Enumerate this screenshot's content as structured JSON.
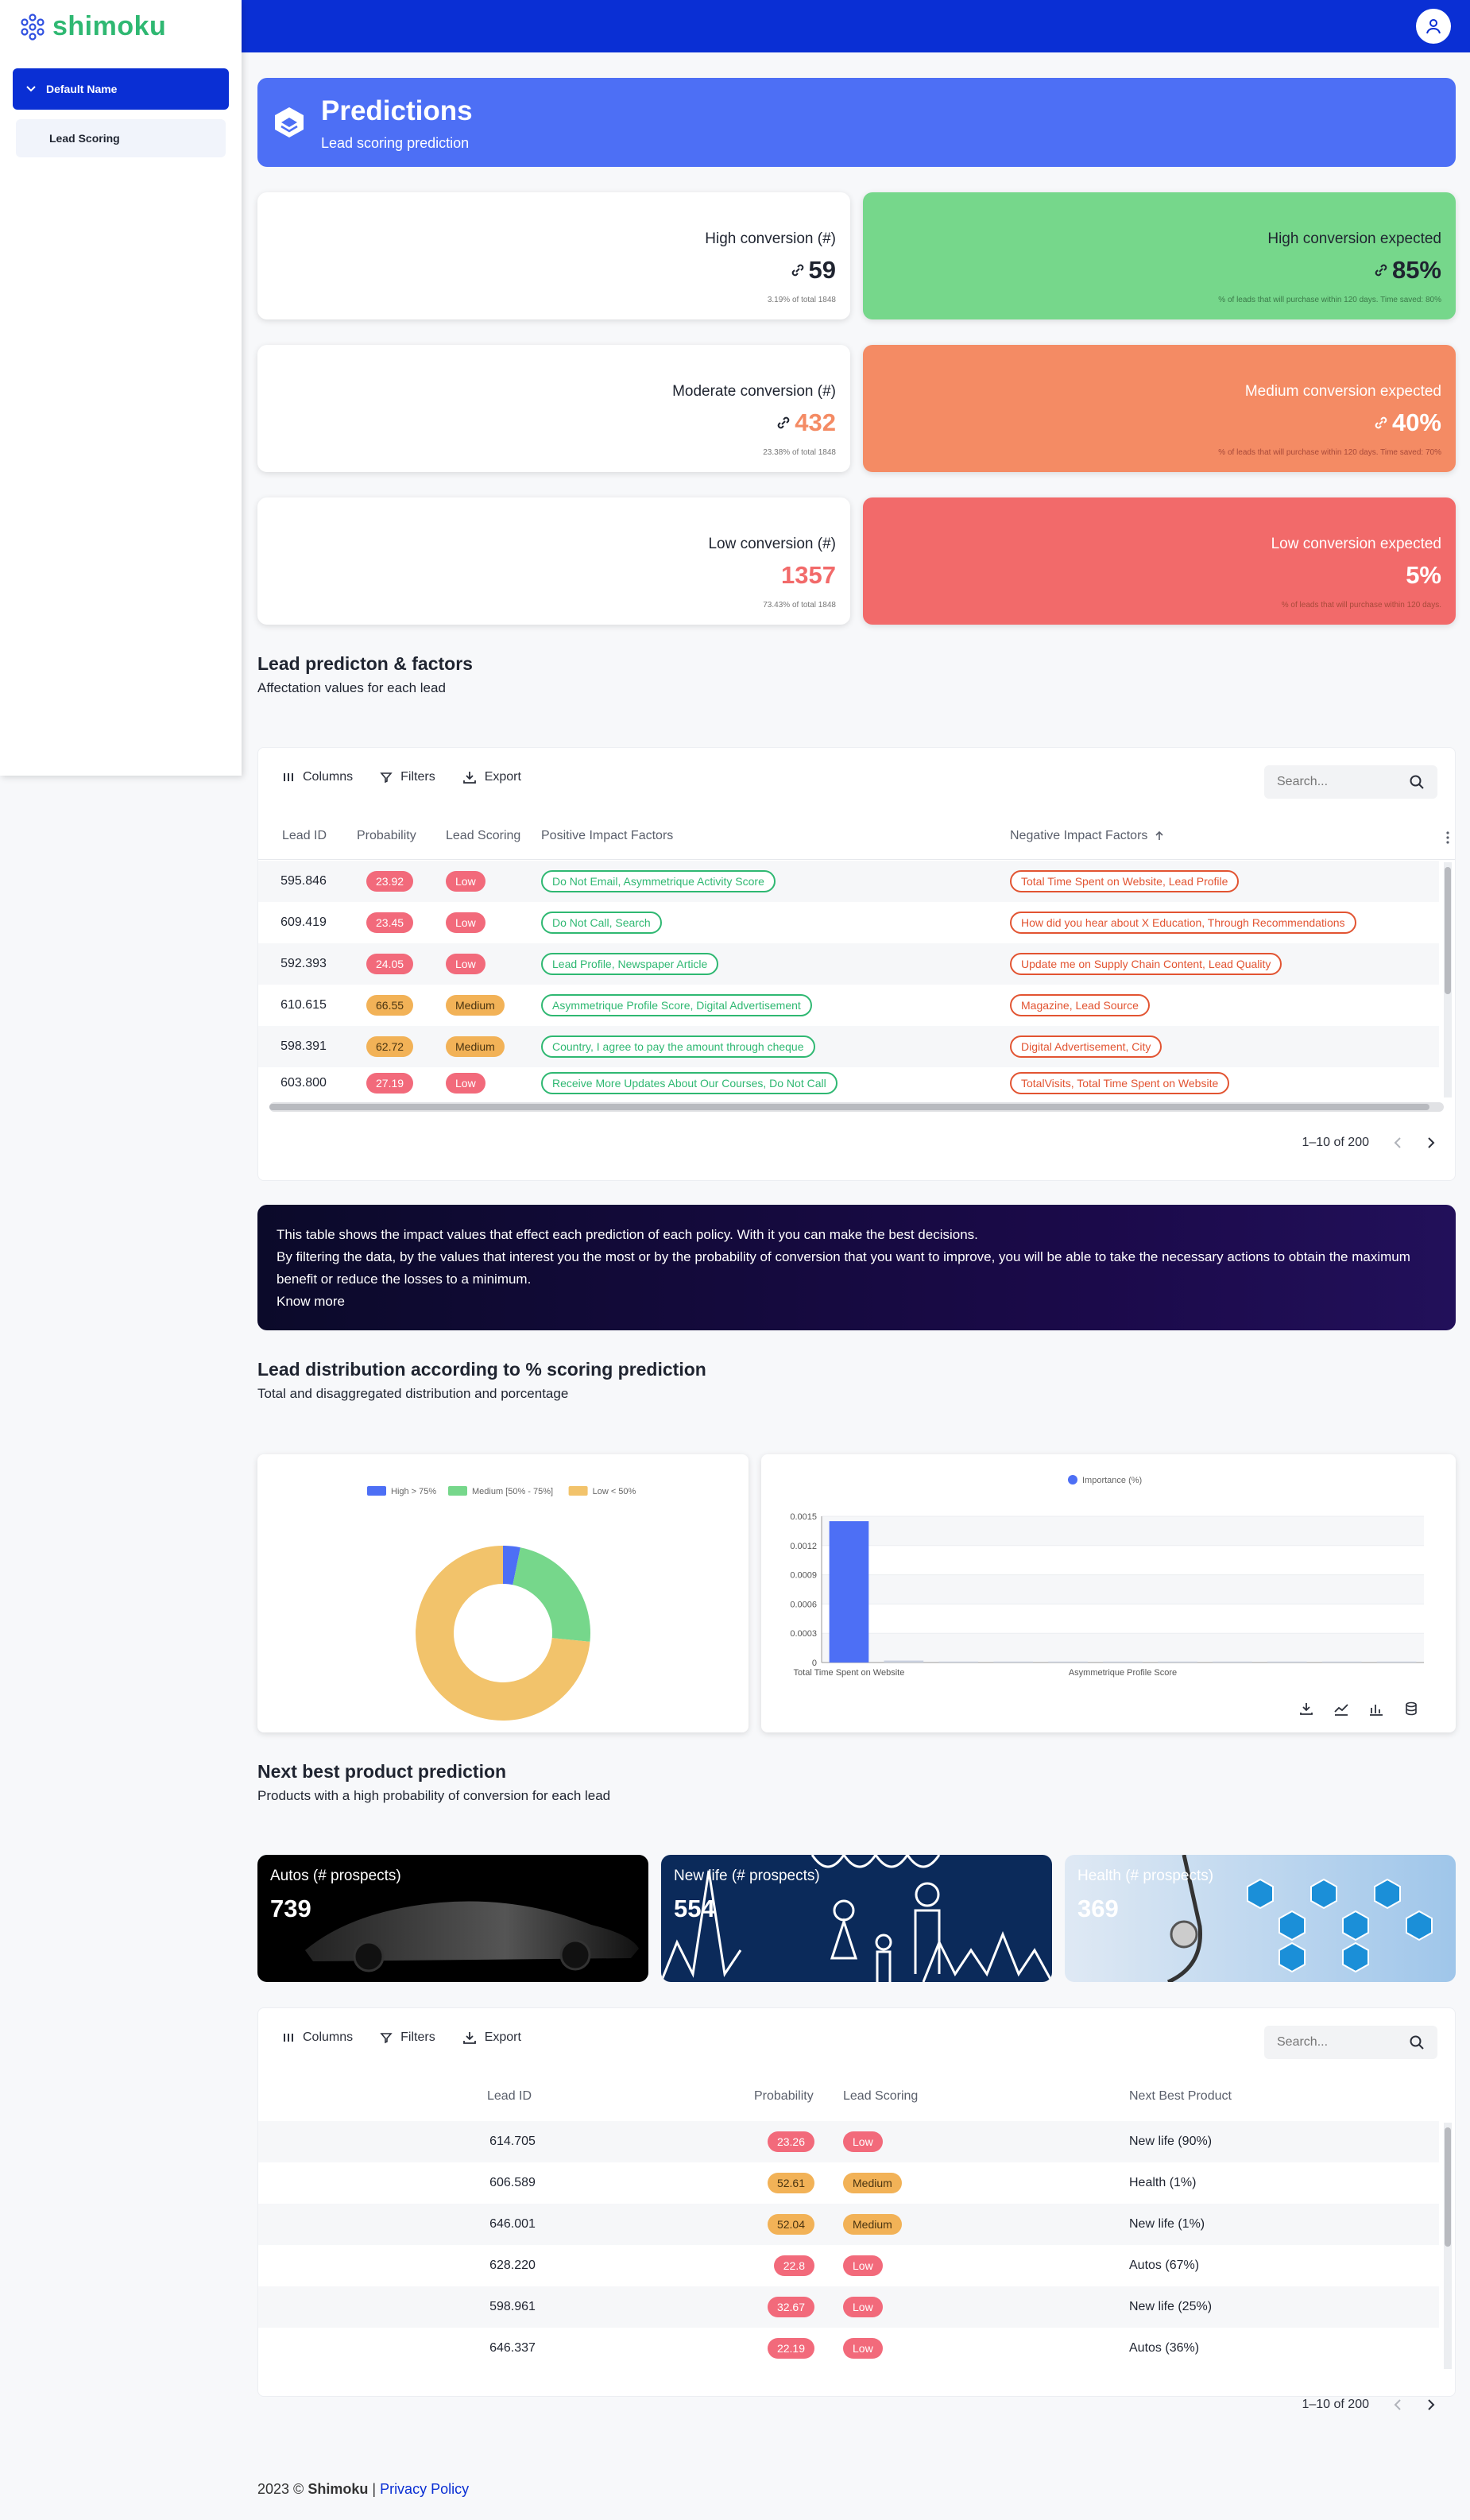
{
  "app": {
    "logo_text": "shimoku"
  },
  "sidebar": {
    "group_label": "Default Name",
    "items": [
      {
        "label": "Lead Scoring"
      }
    ]
  },
  "hero": {
    "title": "Predictions",
    "subtitle": "Lead scoring prediction"
  },
  "indicators": {
    "high_count": {
      "title": "High conversion (#)",
      "value": "59",
      "desc": "3.19% of total 1848"
    },
    "high_expected": {
      "title": "High conversion expected",
      "value": "85%",
      "desc": "% of leads that will purchase within 120 days. Time saved: 80%"
    },
    "moderate_count": {
      "title": "Moderate conversion (#)",
      "value": "432",
      "desc": "23.38% of total 1848"
    },
    "medium_expected": {
      "title": "Medium conversion expected",
      "value": "40%",
      "desc": "% of leads that will purchase within 120 days. Time saved: 70%"
    },
    "low_count": {
      "title": "Low conversion (#)",
      "value": "1357",
      "desc": "73.43% of total 1848"
    },
    "low_expected": {
      "title": "Low conversion expected",
      "value": "5%",
      "desc": "% of leads that will purchase within 120 days."
    }
  },
  "section_factors": {
    "title": "Lead predicton & factors",
    "subtitle": "Affectation values for each lead"
  },
  "toolbar": {
    "columns": "Columns",
    "filters": "Filters",
    "export": "Export",
    "search_placeholder": "Search..."
  },
  "table1": {
    "headers": [
      "Lead ID",
      "Probability",
      "Lead Scoring",
      "Positive Impact Factors",
      "Negative Impact Factors"
    ],
    "rows": [
      {
        "id": "595.846",
        "prob": "23.92",
        "score": "Low",
        "pos": "Do Not Email, Asymmetrique Activity Score",
        "neg": "Total Time Spent on Website, Lead Profile"
      },
      {
        "id": "609.419",
        "prob": "23.45",
        "score": "Low",
        "pos": "Do Not Call, Search",
        "neg": "How did you hear about X Education, Through Recommendations"
      },
      {
        "id": "592.393",
        "prob": "24.05",
        "score": "Low",
        "pos": "Lead Profile, Newspaper Article",
        "neg": "Update me on Supply Chain Content, Lead Quality"
      },
      {
        "id": "610.615",
        "prob": "66.55",
        "score": "Medium",
        "pos": "Asymmetrique Profile Score, Digital Advertisement",
        "neg": "Magazine, Lead Source"
      },
      {
        "id": "598.391",
        "prob": "62.72",
        "score": "Medium",
        "pos": "Country, I agree to pay the amount through cheque",
        "neg": "Digital Advertisement, City"
      },
      {
        "id": "603.800",
        "prob": "27.19",
        "score": "Low",
        "pos": "Receive More Updates About Our Courses, Do Not Call",
        "neg": "TotalVisits, Total Time Spent on Website"
      }
    ],
    "pagination": "1–10 of 200"
  },
  "banner": {
    "line1": "This table shows the impact values that effect each prediction of each policy. With it you can make the best decisions.",
    "line2": "By filtering the data, by the values that interest you the most or by the probability of conversion that you want to improve, you will be able to take the necessary actions to obtain the maximum benefit or reduce the losses to a minimum.",
    "link": "Know more"
  },
  "section_distribution": {
    "title": "Lead distribution according to % scoring prediction",
    "subtitle": "Total and disaggregated distribution and porcentage"
  },
  "chart_data": [
    {
      "type": "pie",
      "donut": true,
      "legend_position": "top",
      "categories": [
        "High > 75%",
        "Medium [50% - 75%]",
        "Low < 50%"
      ],
      "values": [
        59,
        432,
        1357
      ],
      "colors": [
        "#4d6ff5",
        "#76d78b",
        "#f2c36b"
      ]
    },
    {
      "type": "bar",
      "legend_position": "top",
      "series": [
        {
          "name": "Importance (%)",
          "values": [
            0.00145,
            2e-05,
            1e-05,
            1e-05,
            1e-05,
            1e-05,
            1e-05,
            1e-05,
            1e-05,
            1e-05,
            1e-05
          ]
        }
      ],
      "categories": [
        "Total Time Spent on Website",
        "",
        "",
        "",
        "",
        "Asymmetrique Profile Score",
        "",
        "",
        "",
        "",
        ""
      ],
      "tick_labels_x": [
        "Total Time Spent on Website",
        "Asymmetrique Profile Score"
      ],
      "y_ticks": [
        "0",
        "0.0003",
        "0.0006",
        "0.0009",
        "0.0012",
        "0.0015"
      ],
      "ylim": [
        0,
        0.0015
      ],
      "grid": true,
      "color": "#4d6ff5"
    }
  ],
  "section_products": {
    "title": "Next best product prediction",
    "subtitle": "Products with a high probability of conversion for each lead"
  },
  "products": [
    {
      "title": "Autos (# prospects)",
      "value": "739"
    },
    {
      "title": "New life (# prospects)",
      "value": "554"
    },
    {
      "title": "Health (# prospects)",
      "value": "369"
    }
  ],
  "table2": {
    "headers": [
      "Lead ID",
      "Probability",
      "Lead Scoring",
      "Next Best Product"
    ],
    "rows": [
      {
        "id": "614.705",
        "prob": "23.26",
        "score": "Low",
        "product": "New life (90%)"
      },
      {
        "id": "606.589",
        "prob": "52.61",
        "score": "Medium",
        "product": "Health (1%)"
      },
      {
        "id": "646.001",
        "prob": "52.04",
        "score": "Medium",
        "product": "New life (1%)"
      },
      {
        "id": "628.220",
        "prob": "22.8",
        "score": "Low",
        "product": "Autos (67%)"
      },
      {
        "id": "598.961",
        "prob": "32.67",
        "score": "Low",
        "product": "New life (25%)"
      },
      {
        "id": "646.337",
        "prob": "22.19",
        "score": "Low",
        "product": "Autos (36%)"
      }
    ],
    "pagination": "1–10 of 200"
  },
  "footer": {
    "year": "2023 ©",
    "brand": "Shimoku",
    "sep": "|",
    "privacy": "Privacy Policy"
  }
}
